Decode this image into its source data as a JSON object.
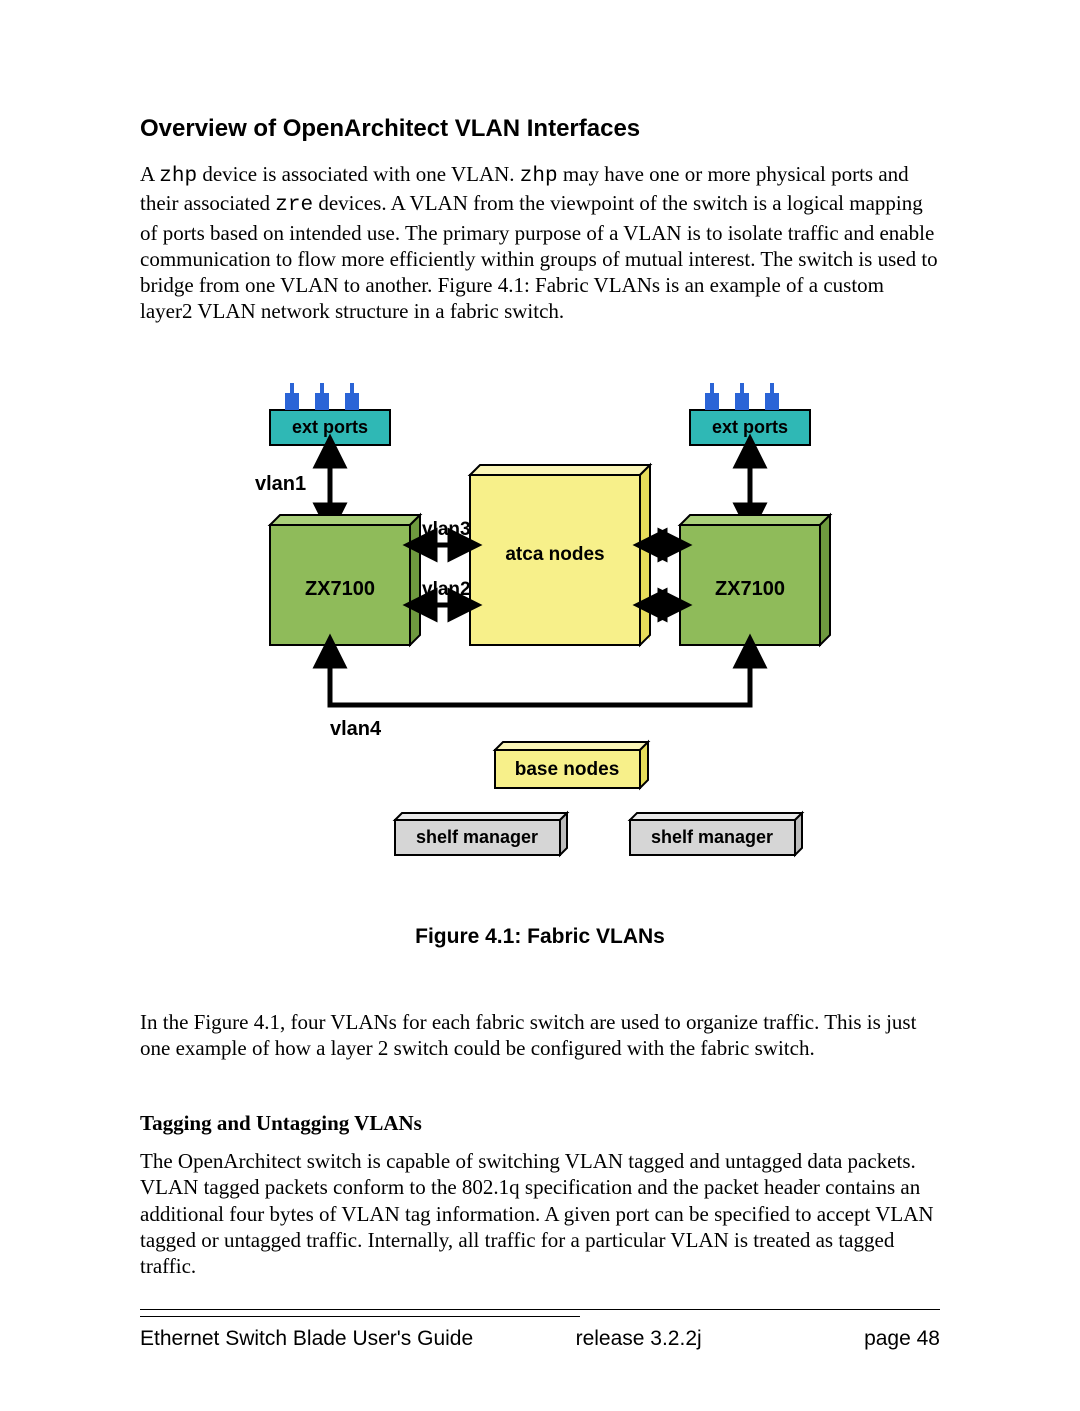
{
  "heading": "Overview of OpenArchitect VLAN Interfaces",
  "paragraph1_parts": {
    "a": "A ",
    "zhp1": "zhp",
    "b": " device is associated with one VLAN. ",
    "zhp2": "zhp",
    "c": " may have one or more physical ports and their associated ",
    "zre": "zre",
    "d": " devices. A VLAN from the viewpoint of the switch is a logical mapping of  ports based on intended use. The primary purpose of a VLAN is to isolate traffic and enable communication to flow more efficiently within groups of mutual interest. The switch is used to bridge from one VLAN to another. Figure 4.1: Fabric VLANs  is an example of a custom layer2 VLAN network structure in a fabric switch."
  },
  "diagram": {
    "ext_ports_left": "ext ports",
    "ext_ports_right": "ext ports",
    "vlan1": "vlan1",
    "vlan2": "vlan2",
    "vlan3": "vlan3",
    "vlan4": "vlan4",
    "zx_left": "ZX7100",
    "zx_right": "ZX7100",
    "atca": "atca nodes",
    "base": "base nodes",
    "shelf_left": "shelf manager",
    "shelf_right": "shelf manager"
  },
  "figure_caption": "Figure 4.1: Fabric VLANs",
  "paragraph2": "In the Figure 4.1, four VLANs for each fabric switch are used to organize traffic. This is just one example of how a layer 2 switch could be configured with the fabric switch.",
  "subheading": "Tagging and Untagging VLANs",
  "paragraph3": "The OpenArchitect switch is capable of switching VLAN tagged and untagged data packets. VLAN tagged packets conform to the 802.1q specification and the packet header contains an additional four bytes of VLAN tag information. A given port can be specified to accept VLAN tagged or untagged traffic. Internally, all traffic for a particular VLAN is treated as tagged traffic.",
  "footer": {
    "title": "Ethernet Switch Blade User's Guide",
    "release": "release  3.2.2j",
    "page": "page 48"
  }
}
